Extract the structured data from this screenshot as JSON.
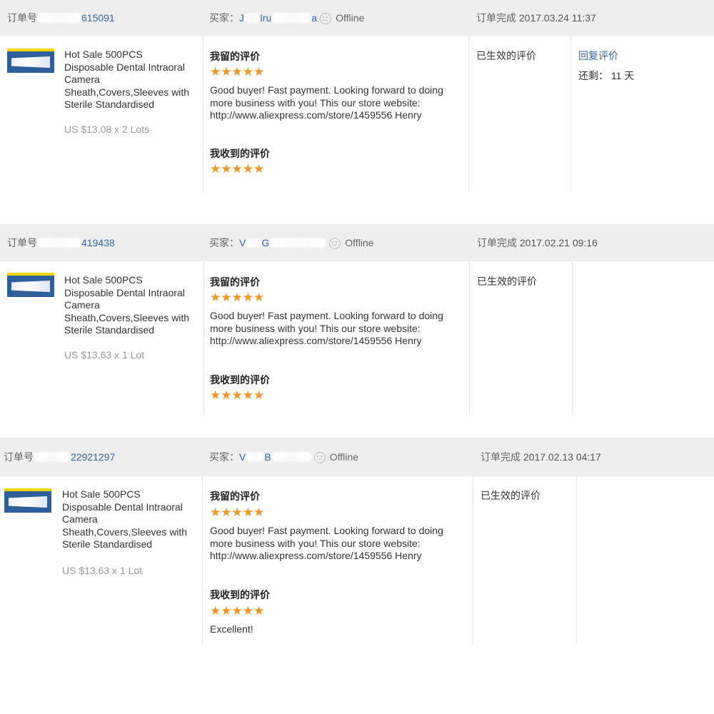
{
  "orders": [
    {
      "order_label": "订单号",
      "order_no": "615091",
      "buyer_label": "买家：",
      "buyer_a": "J",
      "buyer_b": "Iru",
      "buyer_c": "a",
      "status": "Offline",
      "done_label": "订单完成",
      "done_time": "2017.03.24 11:37",
      "product_title": "Hot Sale 500PCS Disposable Dental Intraoral Camera Sheath,Covers,Sleeves with Sterile Standardised",
      "price": "US $13.08 x 2 Lots",
      "my_feedback_title": "我留的评价",
      "my_stars": "★★★★★",
      "my_feedback": "Good buyer! Fast payment. Looking forward to doing more business with you! This our store website: http://www.aliexpress.com/store/1459556 Henry",
      "received_title": "我收到的评价",
      "received_stars": "★★★★★",
      "received_text": "",
      "effective": "已生效的评价",
      "reply": "回复评价",
      "remaining": "还剩：  11 天"
    },
    {
      "order_label": "订单号",
      "order_no": "419438",
      "buyer_label": "买家：",
      "buyer_a": "V",
      "buyer_b": "G",
      "buyer_c": "",
      "status": "Offline",
      "done_label": "订单完成",
      "done_time": "2017.02.21 09:16",
      "product_title": "Hot Sale 500PCS Disposable Dental Intraoral Camera Sheath,Covers,Sleeves with Sterile Standardised",
      "price": "US $13.63 x 1 Lot",
      "my_feedback_title": "我留的评价",
      "my_stars": "★★★★★",
      "my_feedback": "Good buyer! Fast payment. Looking forward to doing more business with you! This our store website: http://www.aliexpress.com/store/1459556 Henry",
      "received_title": "我收到的评价",
      "received_stars": "★★★★★",
      "received_text": "",
      "effective": "已生效的评价",
      "reply": "",
      "remaining": ""
    },
    {
      "order_label": "订单号",
      "order_no": "22921297",
      "buyer_label": "买家：",
      "buyer_a": "V",
      "buyer_b": "B",
      "buyer_c": "",
      "status": "Offline",
      "done_label": "订单完成",
      "done_time": "2017.02.13 04:17",
      "product_title": "Hot Sale 500PCS Disposable Dental Intraoral Camera Sheath,Covers,Sleeves with Sterile Standardised",
      "price": "US $13.63 x 1 Lot",
      "my_feedback_title": "我留的评价",
      "my_stars": "★★★★★",
      "my_feedback": "Good buyer! Fast payment. Looking forward to doing more business with you! This our store website: http://www.aliexpress.com/store/1459556 Henry",
      "received_title": "我收到的评价",
      "received_stars": "★★★★★",
      "received_text": "Excellent!",
      "effective": "已生效的评价",
      "reply": "",
      "remaining": ""
    }
  ],
  "colors": {
    "header_bg": "#eeeeee",
    "link": "#3366aa",
    "star": "#f7931e"
  }
}
